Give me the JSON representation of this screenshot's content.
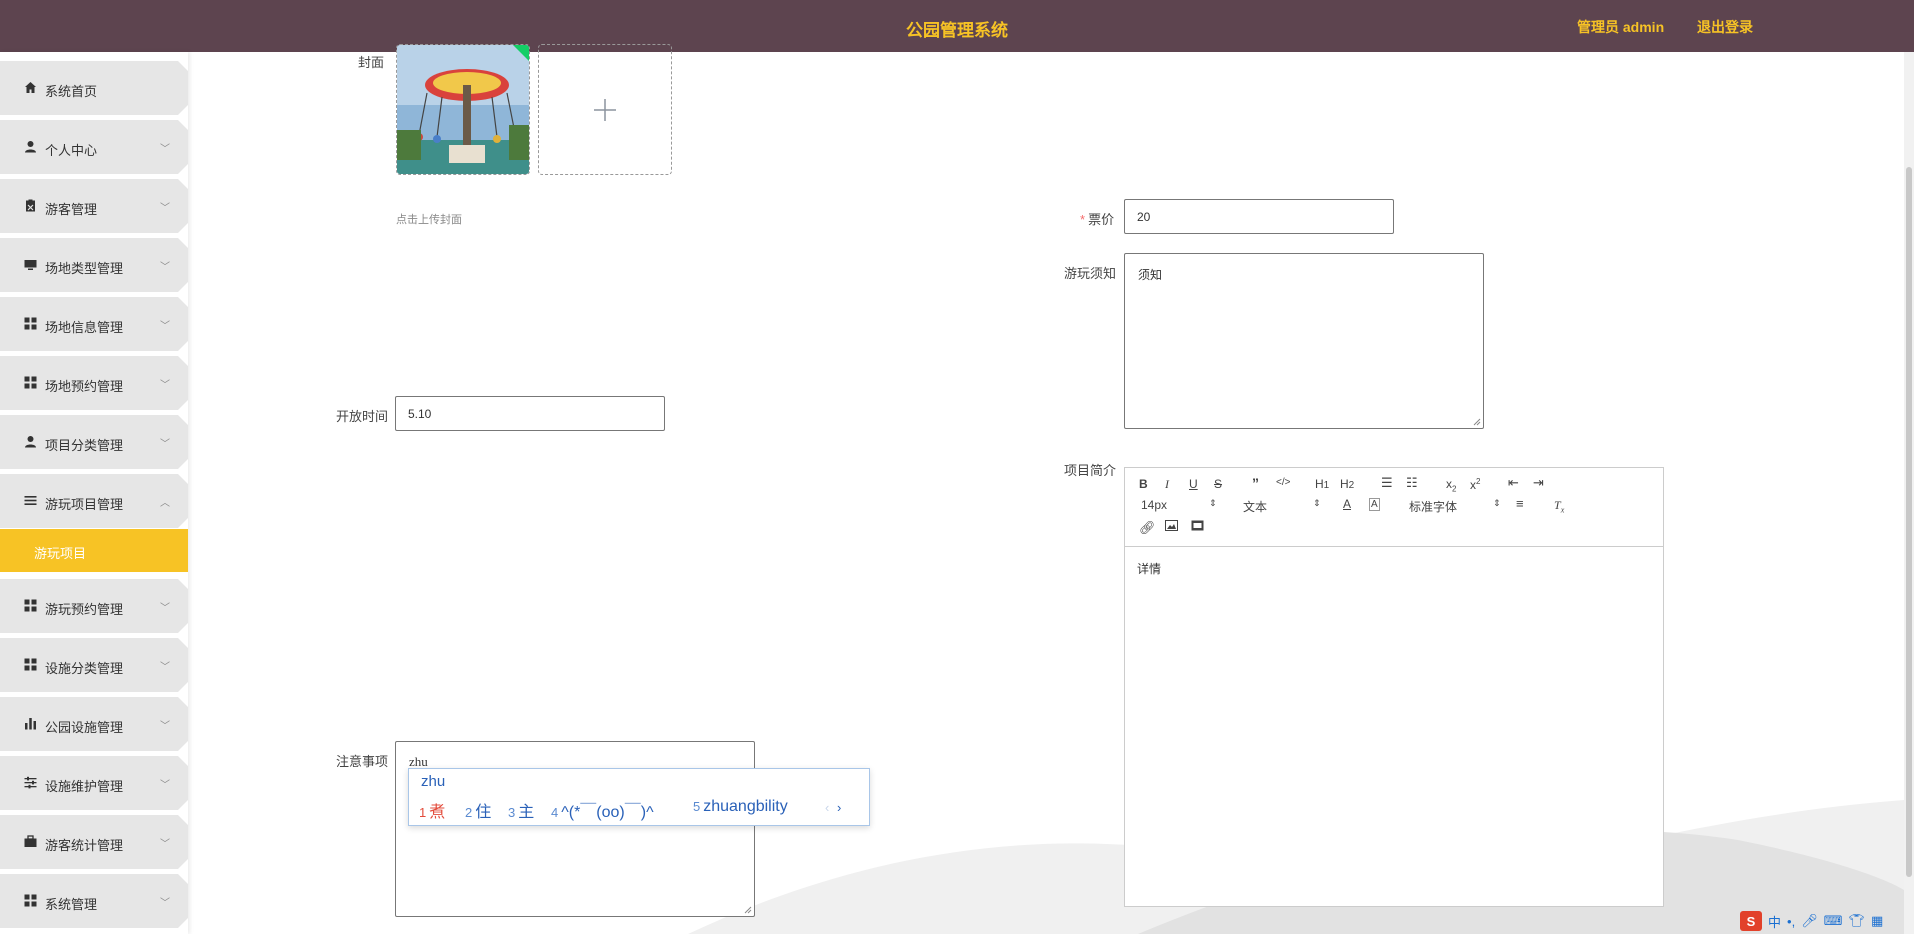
{
  "header": {
    "title": "公园管理系统",
    "user": "管理员 admin",
    "logout": "退出登录"
  },
  "sidebar": {
    "items": [
      {
        "label": "系统首页",
        "icon": "home-icon"
      },
      {
        "label": "个人中心",
        "icon": "person-icon"
      },
      {
        "label": "游客管理",
        "icon": "clipboard-icon"
      },
      {
        "label": "场地类型管理",
        "icon": "monitor-icon"
      },
      {
        "label": "场地信息管理",
        "icon": "grid-icon"
      },
      {
        "label": "场地预约管理",
        "icon": "grid-icon"
      },
      {
        "label": "项目分类管理",
        "icon": "person-icon"
      },
      {
        "label": "游玩项目管理",
        "icon": "list-icon"
      },
      {
        "label": "游玩预约管理",
        "icon": "grid-icon"
      },
      {
        "label": "设施分类管理",
        "icon": "grid-icon"
      },
      {
        "label": "公园设施管理",
        "icon": "bar-chart-icon"
      },
      {
        "label": "设施维护管理",
        "icon": "sliders-icon"
      },
      {
        "label": "游客统计管理",
        "icon": "briefcase-icon"
      },
      {
        "label": "系统管理",
        "icon": "grid-icon"
      }
    ],
    "active_sub": "游玩项目"
  },
  "form": {
    "cover_label": "封面",
    "cover_tip": "点击上传封面",
    "price_label": "票价",
    "price_value": "20",
    "notice_label": "游玩须知",
    "notice_value": "须知",
    "open_label": "开放时间",
    "open_value": "5.10",
    "intro_label": "项目简介",
    "caution_label": "注意事项",
    "caution_value": "zhu"
  },
  "editor": {
    "font_size": "14px",
    "header_select": "文本",
    "font_family": "标准字体",
    "content": "详情"
  },
  "ime": {
    "composition": "zhu",
    "candidates": [
      {
        "num": "1",
        "text": "煮"
      },
      {
        "num": "2",
        "text": "住"
      },
      {
        "num": "3",
        "text": "主"
      },
      {
        "num": "4",
        "text": "^(*￣(oo)￣)^"
      },
      {
        "num": "5",
        "text": "zhuangbility"
      }
    ]
  },
  "tray": {
    "lang": "中"
  },
  "colors": {
    "header_bg": "#5d444f",
    "accent": "#f7c325",
    "menu_bg": "#e6e6e6"
  }
}
